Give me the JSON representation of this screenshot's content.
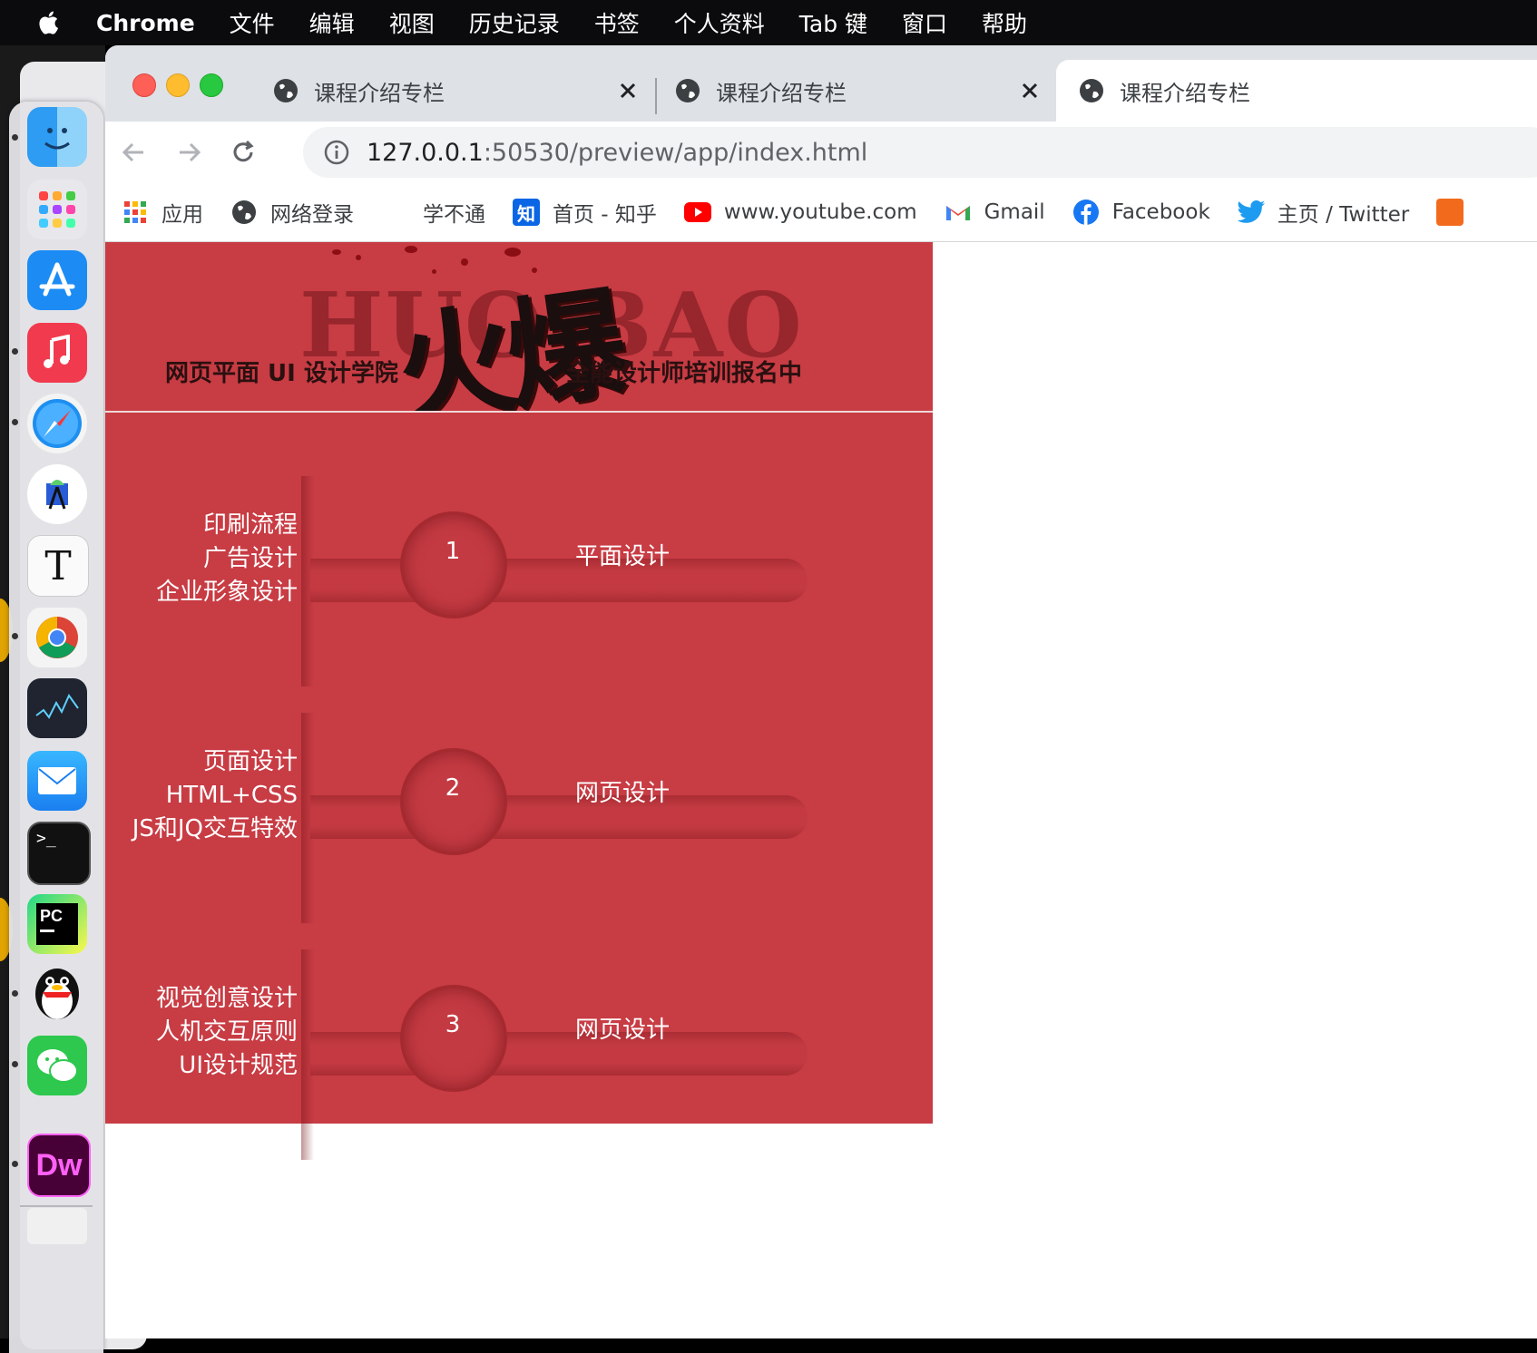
{
  "menubar": {
    "app": "Chrome",
    "items": [
      "文件",
      "编辑",
      "视图",
      "历史记录",
      "书签",
      "个人资料",
      "Tab 键",
      "窗口",
      "帮助"
    ]
  },
  "tabs": [
    {
      "title": "课程介绍专栏",
      "active": false
    },
    {
      "title": "课程介绍专栏",
      "active": false
    },
    {
      "title": "课程介绍专栏",
      "active": true
    }
  ],
  "address": {
    "host": "127.0.0.1",
    "rest": ":50530/preview/app/index.html"
  },
  "bookmarks": [
    {
      "label": "应用",
      "icon": "apps-grid-icon"
    },
    {
      "label": "网络登录",
      "icon": "globe-icon"
    },
    {
      "label": "学不通",
      "icon": "none"
    },
    {
      "label": "首页 - 知乎",
      "icon": "zhihu-icon"
    },
    {
      "label": "www.youtube.com",
      "icon": "youtube-icon"
    },
    {
      "label": "Gmail",
      "icon": "gmail-icon"
    },
    {
      "label": "Facebook",
      "icon": "facebook-icon"
    },
    {
      "label": "主页 / Twitter",
      "icon": "twitter-icon"
    }
  ],
  "banner": {
    "watermark": "HUO BAO",
    "brush_title": "火爆",
    "left_tag": "网页平面 UI 设计学院",
    "right_tag": "全能设计师培训报名中",
    "bg_color": "#c83c44"
  },
  "rows": [
    {
      "skills": [
        "印刷流程",
        "广告设计",
        "企业形象设计"
      ],
      "num": "1",
      "category": "平面设计"
    },
    {
      "skills": [
        "页面设计",
        "HTML+CSS",
        "JS和JQ交互特效"
      ],
      "num": "2",
      "category": "网页设计"
    },
    {
      "skills": [
        "视觉创意设计",
        "人机交互原则",
        "UI设计规范"
      ],
      "num": "3",
      "category": "网页设计"
    }
  ],
  "dock": {
    "apps": [
      "finder-icon",
      "launchpad-icon",
      "app-store-icon",
      "music-icon",
      "safari-icon",
      "android-studio-icon",
      "typora-icon",
      "chrome-icon",
      "stocks-icon",
      "mail-icon",
      "terminal-icon",
      "pycharm-icon",
      "qq-icon",
      "wechat-icon",
      "dreamweaver-icon"
    ],
    "pycharm_label": "PC",
    "dreamweaver_label": "Dw"
  }
}
